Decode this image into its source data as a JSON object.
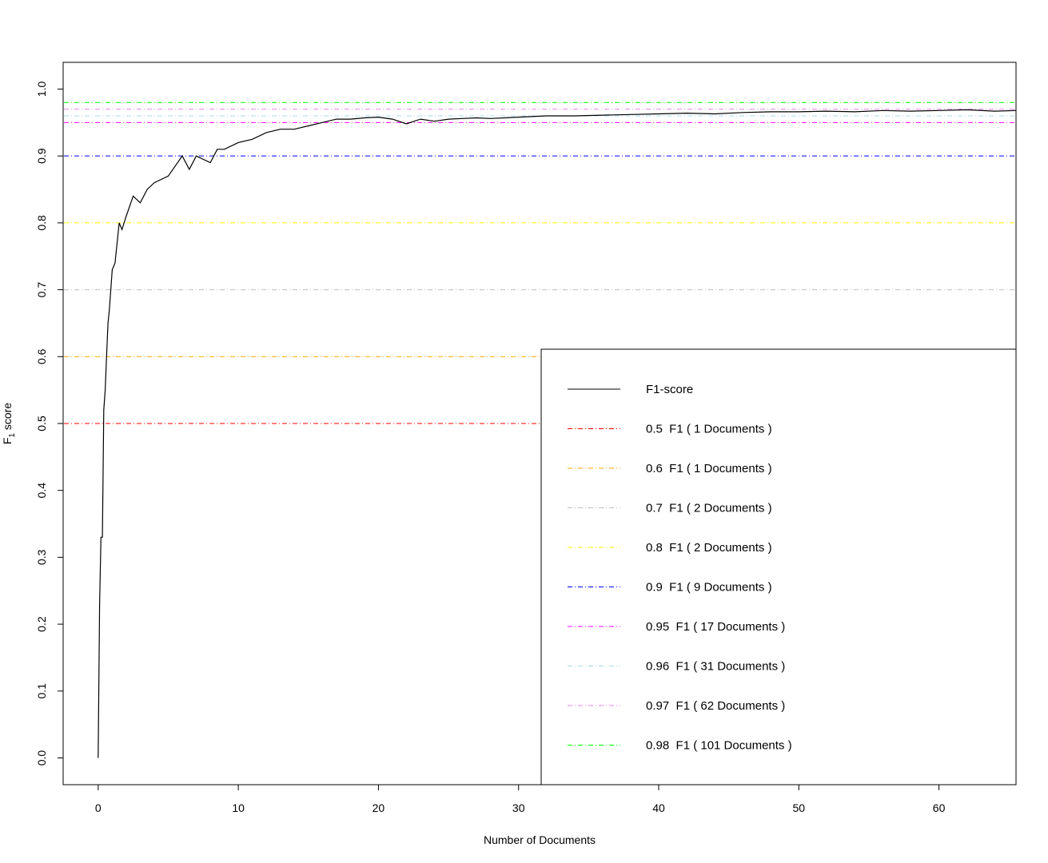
{
  "chart_data": {
    "type": "line",
    "title": "",
    "xlabel": "Number of Documents",
    "ylabel_main": "F",
    "ylabel_sub": "1",
    "ylabel_rest": " score",
    "xlim": [
      -2.5,
      65.5
    ],
    "ylim": [
      -0.04,
      1.04
    ],
    "xticks": [
      0,
      10,
      20,
      30,
      40,
      50,
      60
    ],
    "yticks": [
      0.0,
      0.1,
      0.2,
      0.3,
      0.4,
      0.5,
      0.6,
      0.7,
      0.8,
      0.9,
      1.0
    ],
    "ytick_labels": [
      "0.0",
      "0.1",
      "0.2",
      "0.3",
      "0.4",
      "0.5",
      "0.6",
      "0.7",
      "0.8",
      "0.9",
      "1.0"
    ],
    "grid": false,
    "legend_position": "bottom-right",
    "series": [
      {
        "name": "F1-score",
        "color": "#000000",
        "x": [
          0,
          0.1,
          0.2,
          0.3,
          0.4,
          0.5,
          0.6,
          0.7,
          0.8,
          1.0,
          1.2,
          1.5,
          1.7,
          2.0,
          2.5,
          3.0,
          3.5,
          4.0,
          5.0,
          6.0,
          6.5,
          7.0,
          8.0,
          8.5,
          9.0,
          10.0,
          11.0,
          12.0,
          13.0,
          14.0,
          15.0,
          16.0,
          17.0,
          18.0,
          19.0,
          20.0,
          21.0,
          22.0,
          23.0,
          24.0,
          25.0,
          26.0,
          27.0,
          28.0,
          30.0,
          32.0,
          34.0,
          36.0,
          38.0,
          40.0,
          42.0,
          44.0,
          46.0,
          48.0,
          50.0,
          52.0,
          54.0,
          56.0,
          58.0,
          60.0,
          62.0,
          64.0,
          65.5
        ],
        "y": [
          0.0,
          0.23,
          0.33,
          0.33,
          0.52,
          0.55,
          0.6,
          0.65,
          0.67,
          0.73,
          0.74,
          0.8,
          0.79,
          0.81,
          0.84,
          0.83,
          0.85,
          0.86,
          0.87,
          0.9,
          0.88,
          0.9,
          0.89,
          0.91,
          0.91,
          0.92,
          0.925,
          0.935,
          0.94,
          0.94,
          0.945,
          0.95,
          0.955,
          0.955,
          0.957,
          0.958,
          0.955,
          0.948,
          0.955,
          0.952,
          0.955,
          0.956,
          0.957,
          0.956,
          0.958,
          0.96,
          0.96,
          0.961,
          0.962,
          0.963,
          0.964,
          0.963,
          0.965,
          0.966,
          0.966,
          0.967,
          0.966,
          0.968,
          0.967,
          0.968,
          0.969,
          0.967,
          0.968
        ]
      }
    ],
    "hlines": [
      {
        "value": 0.5,
        "color": "#ff0000",
        "label": "0.5  F1 ( 1 Documents )"
      },
      {
        "value": 0.6,
        "color": "#ffa500",
        "label": "0.6  F1 ( 1 Documents )"
      },
      {
        "value": 0.7,
        "color": "#bebebe",
        "label": "0.7  F1 ( 2 Documents )"
      },
      {
        "value": 0.8,
        "color": "#ffff00",
        "label": "0.8  F1 ( 2 Documents )"
      },
      {
        "value": 0.9,
        "color": "#0000ff",
        "label": "0.9  F1 ( 9 Documents )"
      },
      {
        "value": 0.95,
        "color": "#ff00ff",
        "label": "0.95  F1 ( 17 Documents )"
      },
      {
        "value": 0.96,
        "color": "#add8e6",
        "label": "0.96  F1 ( 31 Documents )"
      },
      {
        "value": 0.97,
        "color": "#ee82ee",
        "label": "0.97  F1 ( 62 Documents )"
      },
      {
        "value": 0.98,
        "color": "#00ff00",
        "label": "0.98  F1 ( 101 Documents )"
      }
    ]
  }
}
